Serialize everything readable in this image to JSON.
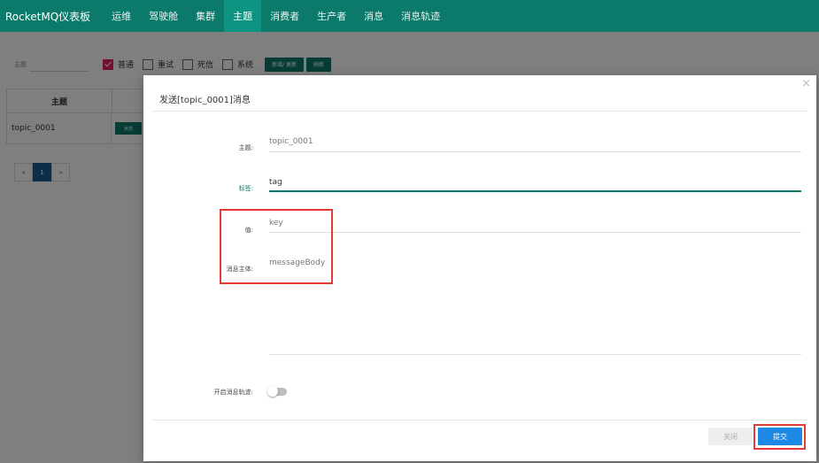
{
  "navbar": {
    "brand": "RocketMQ仪表板",
    "items": [
      "运维",
      "驾驶舱",
      "集群",
      "主题",
      "消费者",
      "生产者",
      "消息",
      "消息轨迹"
    ],
    "active_index": 3
  },
  "filter": {
    "label": "主题",
    "checkboxes": [
      {
        "label": "普通",
        "checked": true
      },
      {
        "label": "重试",
        "checked": false
      },
      {
        "label": "死信",
        "checked": false
      },
      {
        "label": "系统",
        "checked": false
      }
    ],
    "add_update_label": "新增/ 更新",
    "refresh_label": "刷新"
  },
  "table": {
    "header": "主题",
    "rows": [
      {
        "topic": "topic_0001",
        "status_label": "状态"
      }
    ]
  },
  "pagination": {
    "prev": "«",
    "current": "1",
    "next": "»"
  },
  "modal": {
    "title": "发送[topic_0001]消息",
    "close_icon": "×",
    "fields": {
      "topic_label": "主题:",
      "topic_value": "topic_0001",
      "tag_label": "标签:",
      "tag_value": "tag",
      "key_label": "值:",
      "key_placeholder": "key",
      "body_label": "消息主体:",
      "body_placeholder": "messageBody"
    },
    "trace_label": "开启消息轨迹:",
    "trace_enabled": false,
    "close_button": "关闭",
    "submit_button": "提交"
  },
  "colors": {
    "navbar": "#0b7a6b",
    "accent": "#0b7a6b",
    "submit": "#1e88e5",
    "highlight": "#e53935"
  }
}
